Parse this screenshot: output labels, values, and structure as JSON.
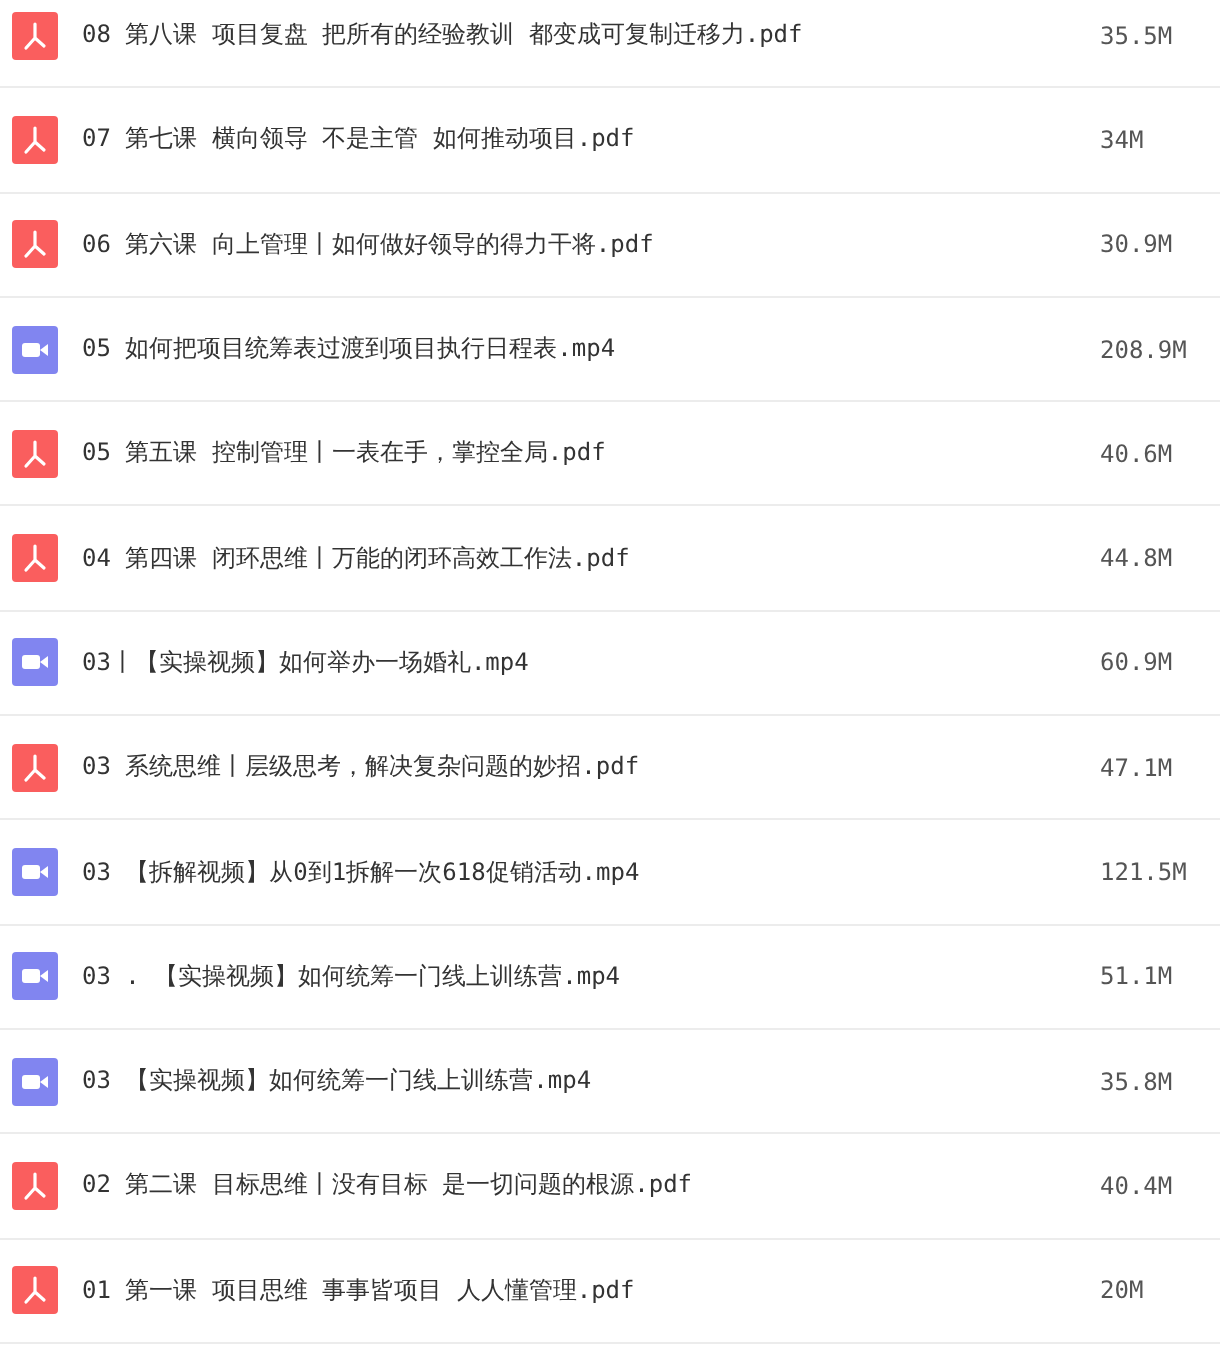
{
  "files": [
    {
      "kind": "pdf",
      "name": "08 第八课 项目复盘 把所有的经验教训 都变成可复制迁移力.pdf",
      "size": "35.5M"
    },
    {
      "kind": "pdf",
      "name": "07 第七课 横向领导 不是主管 如何推动项目.pdf",
      "size": "34M"
    },
    {
      "kind": "pdf",
      "name": "06 第六课 向上管理丨如何做好领导的得力干将.pdf",
      "size": "30.9M"
    },
    {
      "kind": "video",
      "name": "05 如何把项目统筹表过渡到项目执行日程表.mp4",
      "size": "208.9M"
    },
    {
      "kind": "pdf",
      "name": "05 第五课 控制管理丨一表在手，掌控全局.pdf",
      "size": "40.6M"
    },
    {
      "kind": "pdf",
      "name": "04 第四课 闭环思维丨万能的闭环高效工作法.pdf",
      "size": "44.8M"
    },
    {
      "kind": "video",
      "name": "03丨【实操视频】如何举办一场婚礼.mp4",
      "size": "60.9M"
    },
    {
      "kind": "pdf",
      "name": "03 系统思维丨层级思考，解决复杂问题的妙招.pdf",
      "size": "47.1M"
    },
    {
      "kind": "video",
      "name": "03 【拆解视频】从0到1拆解一次618促销活动.mp4",
      "size": "121.5M"
    },
    {
      "kind": "video",
      "name": "03 . 【实操视频】如何统筹一门线上训练营.mp4",
      "size": "51.1M"
    },
    {
      "kind": "video",
      "name": "03 【实操视频】如何统筹一门线上训练营.mp4",
      "size": "35.8M"
    },
    {
      "kind": "pdf",
      "name": "02 第二课 目标思维丨没有目标 是一切问题的根源.pdf",
      "size": "40.4M"
    },
    {
      "kind": "pdf",
      "name": "01 第一课 项目思维 事事皆项目 人人懂管理.pdf",
      "size": "20M"
    }
  ]
}
